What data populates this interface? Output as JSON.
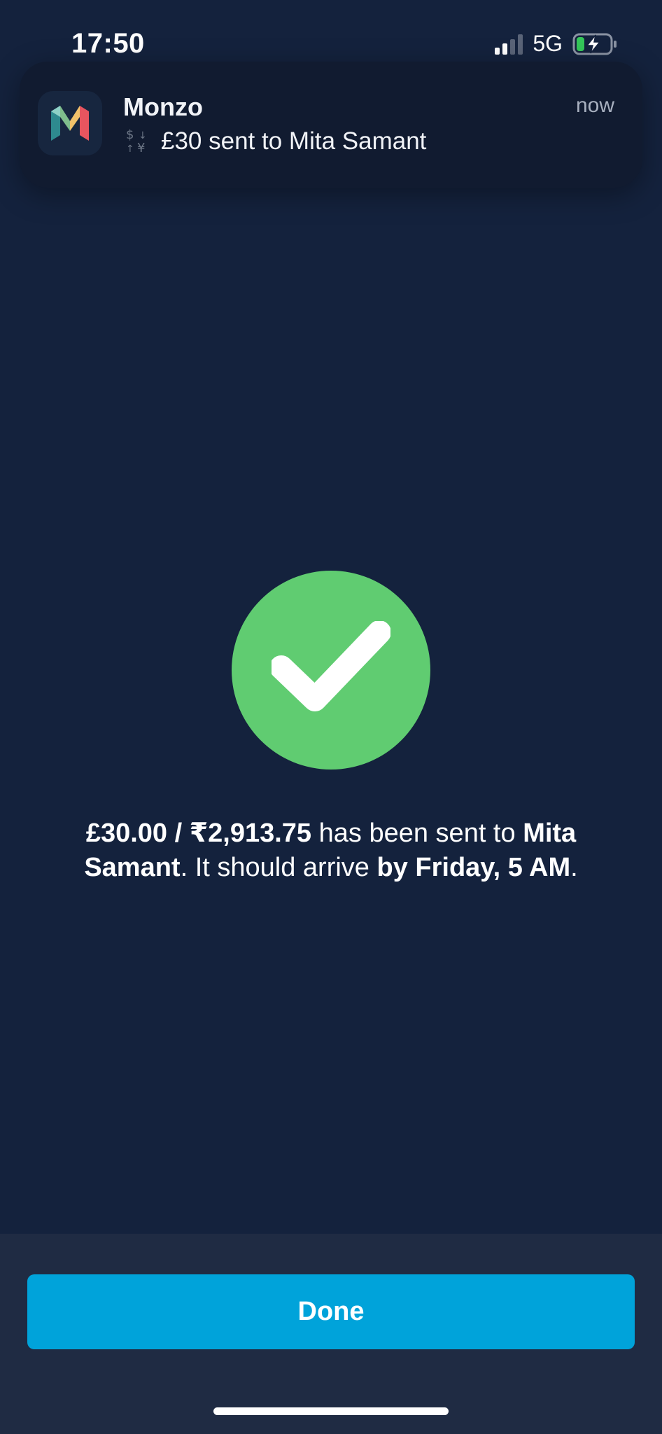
{
  "status_bar": {
    "time": "17:50",
    "network": "5G",
    "signal_bars_active": 2,
    "signal_bars_total": 4,
    "battery_charging": true
  },
  "notification": {
    "app_name": "Monzo",
    "time": "now",
    "icon": "currency-exchange-icon",
    "body": "£30 sent to Mita Samant"
  },
  "success": {
    "icon": "checkmark-icon",
    "color": "#60cc71",
    "message": {
      "amounts": "£30.00 / ₹2,913.75",
      "sent_to_text": " has been sent to ",
      "recipient": "Mita Samant",
      "arrive_text": ". It should arrive ",
      "arrival": "by Friday, 5 AM",
      "end": "."
    }
  },
  "actions": {
    "done_label": "Done",
    "done_color": "#00a3da"
  },
  "colors": {
    "background": "#14223d",
    "bottom_panel": "#1f2b43"
  }
}
